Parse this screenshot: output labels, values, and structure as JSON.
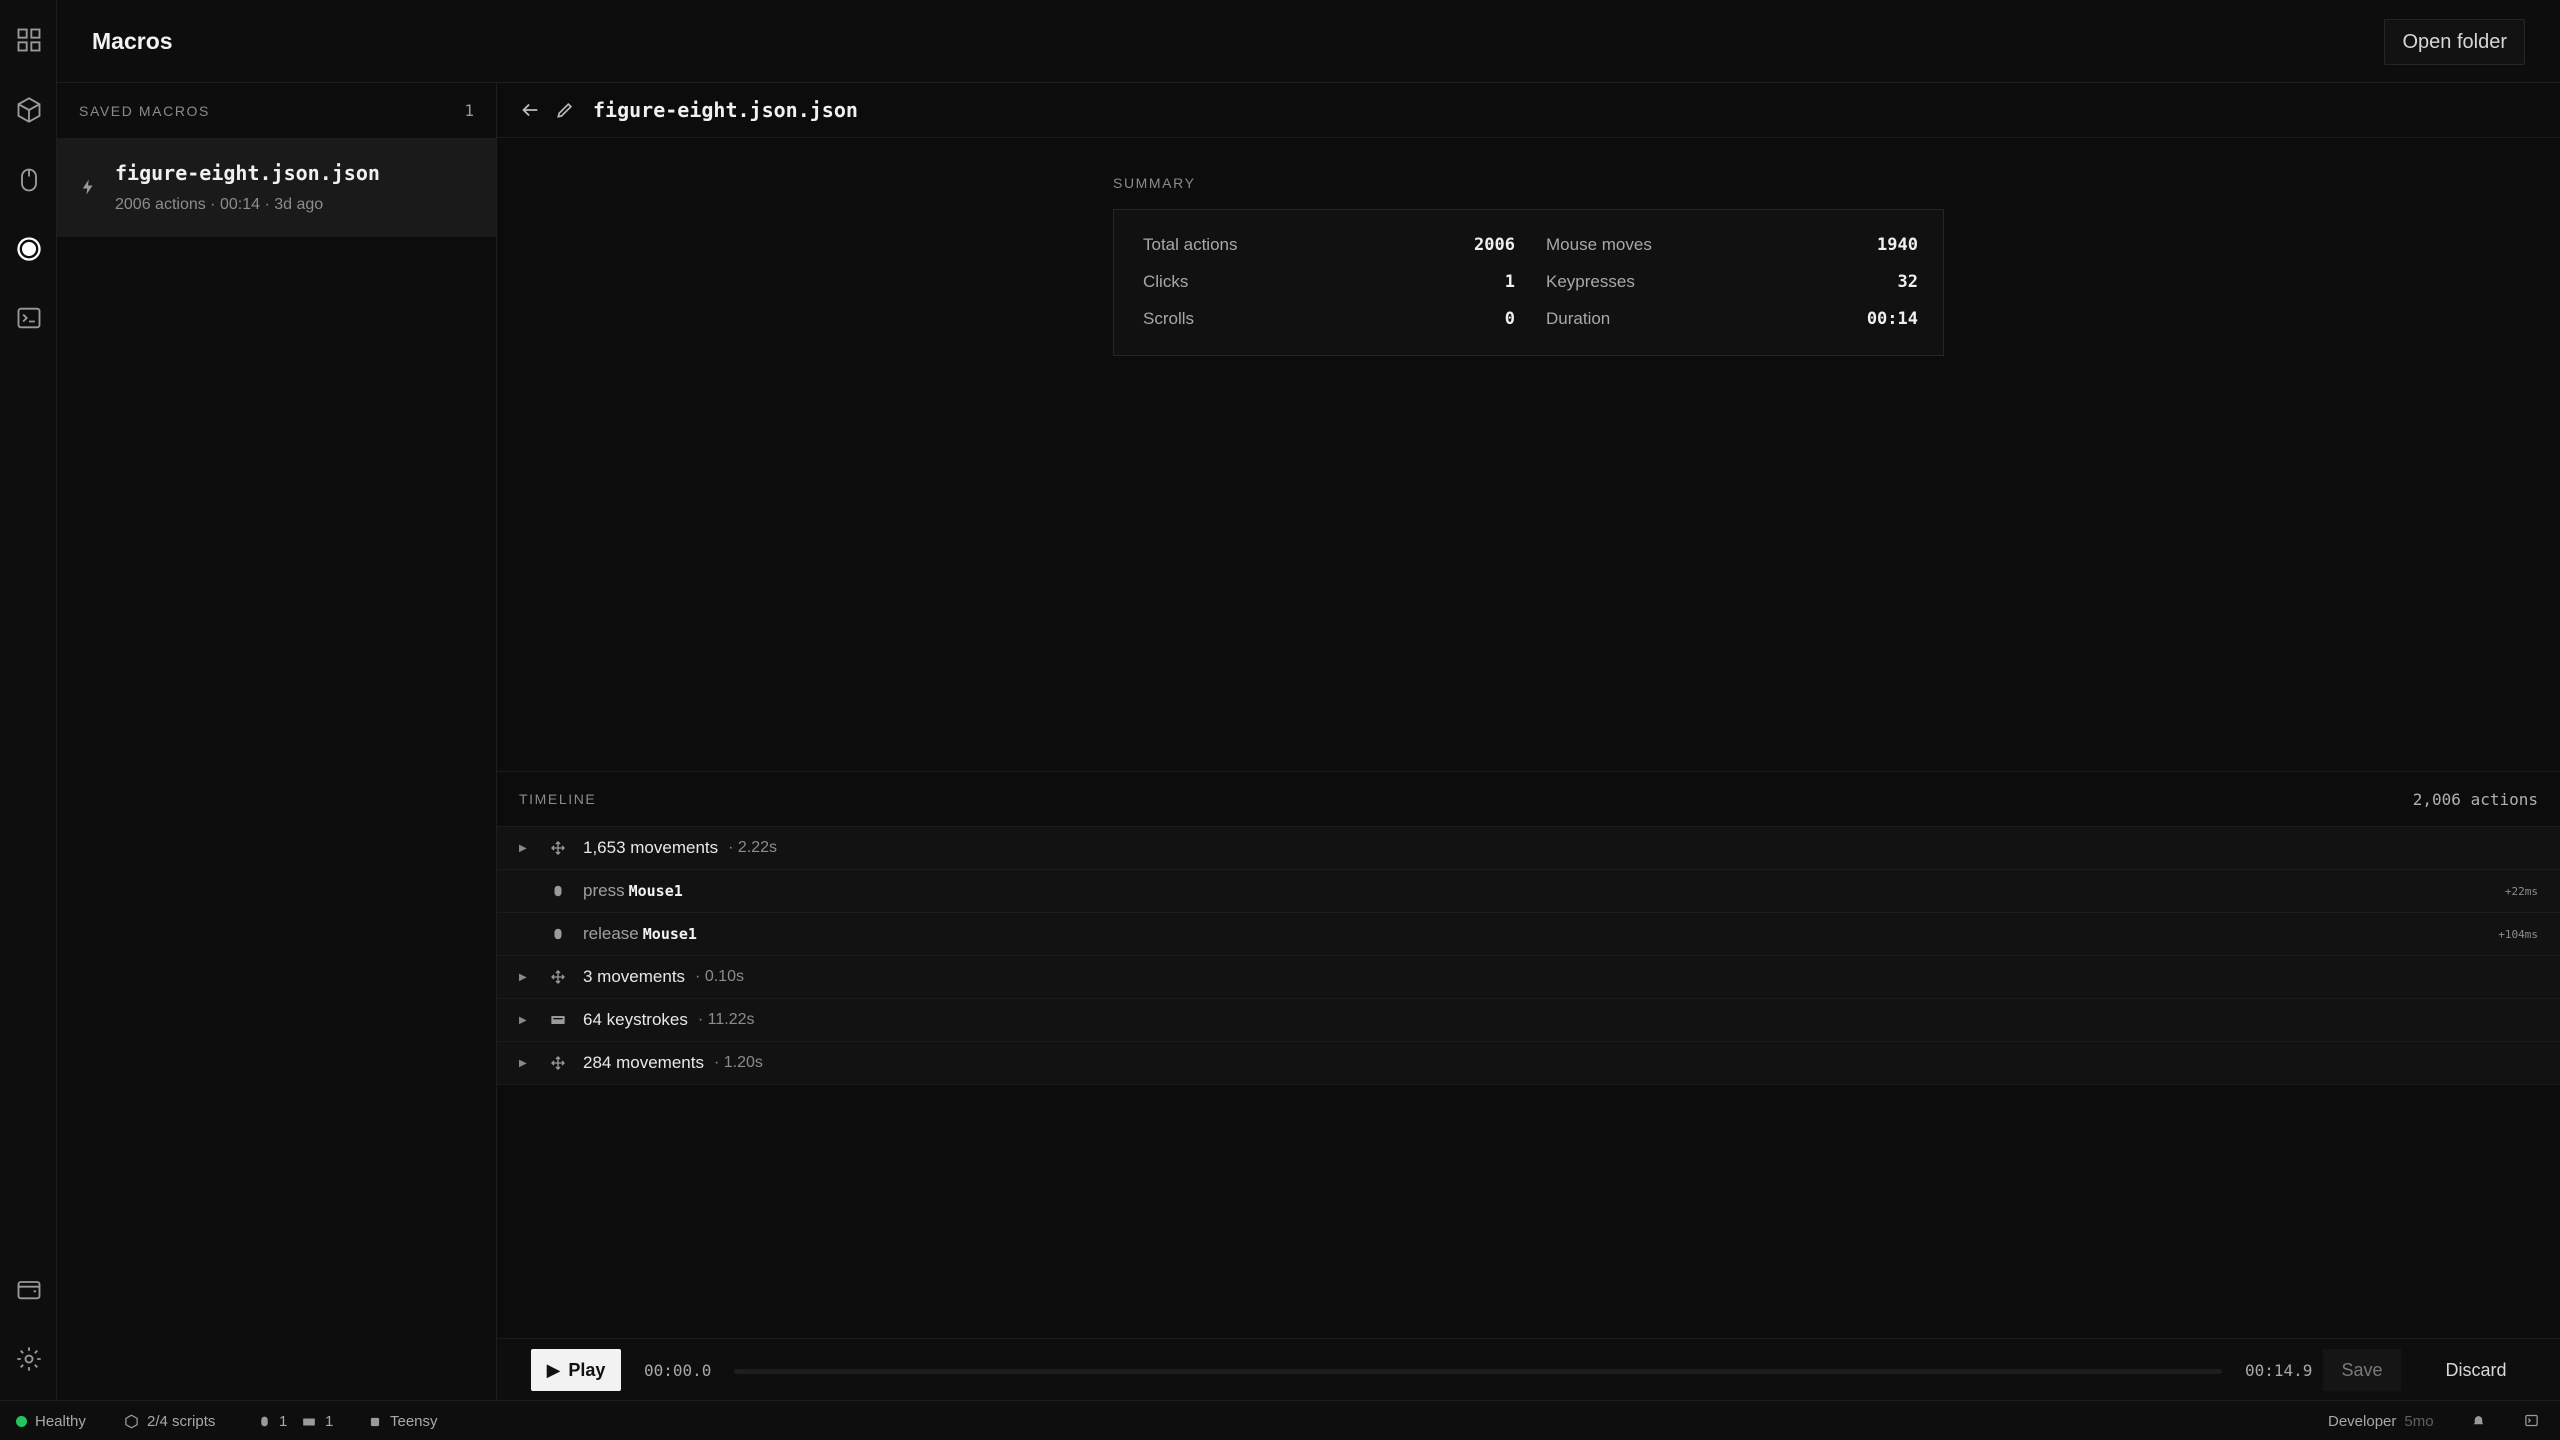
{
  "app": {
    "title": "Macros",
    "open_folder_label": "Open folder"
  },
  "rail": {
    "items": [
      "apps-grid-icon",
      "package-icon",
      "mouse-icon",
      "record-icon",
      "terminal-icon"
    ],
    "bottom": [
      "wallet-icon",
      "gear-icon"
    ]
  },
  "saved": {
    "label": "SAVED MACROS",
    "count": "1",
    "items": [
      {
        "name": "figure-eight.json.json",
        "meta": "2006 actions · 00:14 · 3d ago"
      }
    ]
  },
  "detail": {
    "title": "figure-eight.json.json",
    "summary_label": "SUMMARY",
    "summary": {
      "total_actions": {
        "label": "Total actions",
        "value": "2006"
      },
      "mouse_moves": {
        "label": "Mouse moves",
        "value": "1940"
      },
      "clicks": {
        "label": "Clicks",
        "value": "1"
      },
      "keypresses": {
        "label": "Keypresses",
        "value": "32"
      },
      "scrolls": {
        "label": "Scrolls",
        "value": "0"
      },
      "duration": {
        "label": "Duration",
        "value": "00:14"
      }
    }
  },
  "timeline": {
    "label": "TIMELINE",
    "count": "2,006 actions",
    "rows": [
      {
        "type": "group",
        "icon": "move-icon",
        "text": "1,653 movements",
        "duration": "· 2.22s"
      },
      {
        "type": "event",
        "icon": "mouse-icon",
        "verb": "press",
        "key": "Mouse1",
        "offset": "+22ms"
      },
      {
        "type": "event",
        "icon": "mouse-icon",
        "verb": "release",
        "key": "Mouse1",
        "offset": "+104ms"
      },
      {
        "type": "group",
        "icon": "move-icon",
        "text": "3 movements",
        "duration": "· 0.10s"
      },
      {
        "type": "group",
        "icon": "keyboard-icon",
        "text": "64 keystrokes",
        "duration": "· 11.22s"
      },
      {
        "type": "group",
        "icon": "move-icon",
        "text": "284 movements",
        "duration": "· 1.20s"
      }
    ]
  },
  "player": {
    "play_label": "Play",
    "time_start": "00:00.0",
    "time_end": "00:14.9",
    "progress": 0.0,
    "save_label": "Save",
    "discard_label": "Discard"
  },
  "status": {
    "health": "Healthy",
    "scripts": "2/4 scripts",
    "mouse_count": "1",
    "keyboard_count": "1",
    "device": "Teensy",
    "mode": "Developer",
    "mode_age": "5mo",
    "health_color": "#22c55e"
  }
}
